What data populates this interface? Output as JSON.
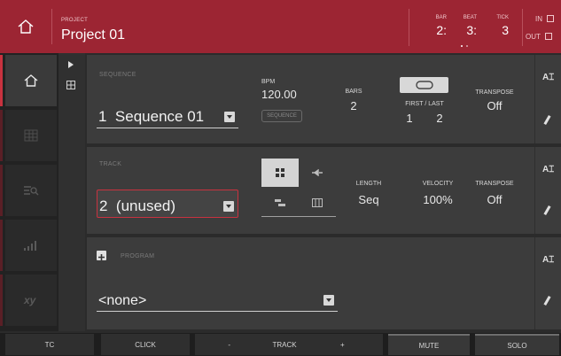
{
  "header": {
    "project_label": "PROJECT",
    "project_name": "Project 01",
    "bar_label": "BAR",
    "bar_value": "2:",
    "beat_label": "BEAT",
    "beat_value": "3:",
    "tick_label": "TICK",
    "tick_value": "3",
    "in_label": "IN",
    "out_label": "OUT",
    "icons": {
      "home": "home-icon"
    }
  },
  "nav": {
    "tabs": [
      "home-icon",
      "grid-icon",
      "mixer-search-icon",
      "level-bars-icon",
      "xy-icon"
    ],
    "active": 0,
    "subnav": [
      "play-arrow-icon",
      "pad-grid-icon"
    ]
  },
  "sequence": {
    "section_label": "SEQUENCE",
    "number": "1",
    "name": "Sequence 01",
    "bpm_label": "BPM",
    "bpm_value": "120.00",
    "bpm_source": "SEQUENCE",
    "bars_label": "BARS",
    "bars_value": "2",
    "first_last_label": "FIRST / LAST",
    "first_value": "1",
    "last_value": "2",
    "transpose_label": "TRANSPOSE",
    "transpose_value": "Off"
  },
  "track": {
    "section_label": "TRACK",
    "number": "2",
    "name": "(unused)",
    "length_label": "LENGTH",
    "length_value": "Seq",
    "velocity_label": "VELOCITY",
    "velocity_value": "100%",
    "transpose_label": "TRANSPOSE",
    "transpose_value": "Off"
  },
  "program": {
    "section_label": "PROGRAM",
    "value": "<none>"
  },
  "bottom": {
    "buttons": [
      "TC",
      "CLICK",
      "-",
      "TRACK",
      "+",
      "MUTE",
      "SOLO"
    ]
  },
  "colors": {
    "header": "#9c2533",
    "accent": "#c8323f",
    "panel": "#3c3c3c"
  }
}
